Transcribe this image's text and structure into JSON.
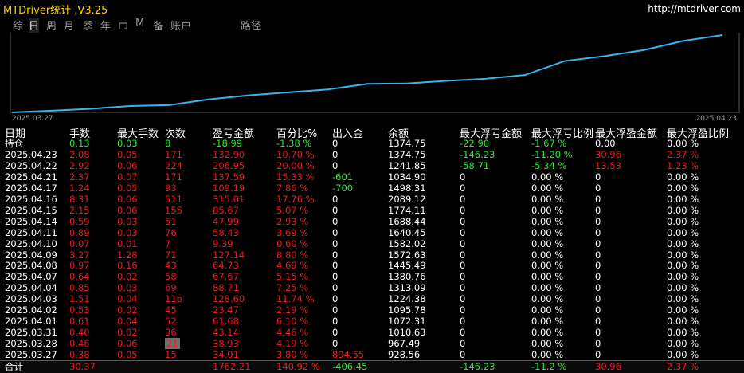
{
  "window": {
    "title": "MTDriver统计 ,V3.25",
    "url": "http://mtdriver.com"
  },
  "colors": {
    "profit": "#e81d1d",
    "loss": "#2ee62e",
    "curve": "#3ab4f0",
    "bg": "#000000"
  },
  "tabs": [
    {
      "label": "综",
      "active": false
    },
    {
      "label": "日",
      "active": true
    },
    {
      "label": "周",
      "active": false
    },
    {
      "label": "月",
      "active": false
    },
    {
      "label": "季",
      "active": false
    },
    {
      "label": "年",
      "active": false
    },
    {
      "label": "巾",
      "active": false
    },
    {
      "label": "M",
      "active": false
    },
    {
      "label": "备",
      "active": false
    },
    {
      "label": "账户",
      "active": false
    },
    {
      "label": "路径",
      "active": false
    }
  ],
  "chart_data": {
    "type": "line",
    "x": [
      "2025.03.27",
      "2025.03.28",
      "2025.03.31",
      "2025.04.01",
      "2025.04.02",
      "2025.04.03",
      "2025.04.04",
      "2025.04.07",
      "2025.04.08",
      "2025.04.09",
      "2025.04.10",
      "2025.04.11",
      "2025.04.14",
      "2025.04.15",
      "2025.04.16",
      "2025.04.17",
      "2025.04.21",
      "2025.04.22",
      "2025.04.23"
    ],
    "series": [
      {
        "values": [
          928.56,
          967.49,
          1010.63,
          1072.31,
          1095.78,
          1224.38,
          1313.09,
          1380.76,
          1445.49,
          1572.63,
          1582.02,
          1640.45,
          1688.44,
          1774.11,
          2089.12,
          2198.31,
          2335.9,
          2542.85,
          2675.75
        ]
      }
    ],
    "x_tick_labels": [
      "2025.03.27",
      "2025.04.23"
    ]
  },
  "headers": {
    "date": "日期",
    "lots": "手数",
    "max_lots": "最大手数",
    "count": "次数",
    "pnl": "盈亏金额",
    "pct": "百分比%",
    "inout": "出入金",
    "balance": "余额",
    "max_float_loss": "最大浮亏金额",
    "max_float_loss_pct": "最大浮亏比例",
    "max_float_profit": "最大浮盈金额",
    "max_float_profit_pct": "最大浮盈比例"
  },
  "rows": [
    {
      "date": "持仓",
      "lots": "0.13",
      "max_lots": "0.03",
      "count": "8",
      "pnl": "-18.99",
      "pct": "-1.38 %",
      "inout": "0",
      "balance": "1374.75",
      "mfl": "-22.90",
      "mflp": "-1.67 %",
      "mfp": "0.00",
      "mfpp": "0.00 %",
      "tone": "green"
    },
    {
      "date": "2025.04.23",
      "lots": "2.08",
      "max_lots": "0.05",
      "count": "171",
      "pnl": "132.90",
      "pct": "10.70 %",
      "inout": "0",
      "balance": "1374.75",
      "mfl": "-146.23",
      "mflp": "-11.20 %",
      "mfp": "30.96",
      "mfpp": "2.37 %",
      "tone": "red"
    },
    {
      "date": "2025.04.22",
      "lots": "2.92",
      "max_lots": "0.06",
      "count": "224",
      "pnl": "206.95",
      "pct": "20.00 %",
      "inout": "0",
      "balance": "1241.85",
      "mfl": "-58.71",
      "mflp": "-5.34 %",
      "mfp": "13.53",
      "mfpp": "1.23 %",
      "tone": "red"
    },
    {
      "date": "2025.04.21",
      "lots": "2.37",
      "max_lots": "0.07",
      "count": "171",
      "pnl": "137.59",
      "pct": "15.33 %",
      "inout": "-601",
      "balance": "1034.90",
      "mfl": "0",
      "mflp": "0.00 %",
      "mfp": "0",
      "mfpp": "0.00 %",
      "tone": "red"
    },
    {
      "date": "2025.04.17",
      "lots": "1.24",
      "max_lots": "0.05",
      "count": "93",
      "pnl": "109.19",
      "pct": "7.86 %",
      "inout": "-700",
      "balance": "1498.31",
      "mfl": "0",
      "mflp": "0.00 %",
      "mfp": "0",
      "mfpp": "0.00 %",
      "tone": "red"
    },
    {
      "date": "2025.04.16",
      "lots": "8.31",
      "max_lots": "0.06",
      "count": "511",
      "pnl": "315.01",
      "pct": "17.76 %",
      "inout": "0",
      "balance": "2089.12",
      "mfl": "0",
      "mflp": "0.00 %",
      "mfp": "0",
      "mfpp": "0.00 %",
      "tone": "red"
    },
    {
      "date": "2025.04.15",
      "lots": "2.15",
      "max_lots": "0.06",
      "count": "155",
      "pnl": "85.67",
      "pct": "5.07 %",
      "inout": "0",
      "balance": "1774.11",
      "mfl": "0",
      "mflp": "0.00 %",
      "mfp": "0",
      "mfpp": "0.00 %",
      "tone": "red"
    },
    {
      "date": "2025.04.14",
      "lots": "0.59",
      "max_lots": "0.03",
      "count": "51",
      "pnl": "47.99",
      "pct": "2.93 %",
      "inout": "0",
      "balance": "1688.44",
      "mfl": "0",
      "mflp": "0.00 %",
      "mfp": "0",
      "mfpp": "0.00 %",
      "tone": "red"
    },
    {
      "date": "2025.04.11",
      "lots": "0.89",
      "max_lots": "0.03",
      "count": "76",
      "pnl": "58.43",
      "pct": "3.69 %",
      "inout": "0",
      "balance": "1640.45",
      "mfl": "0",
      "mflp": "0.00 %",
      "mfp": "0",
      "mfpp": "0.00 %",
      "tone": "red"
    },
    {
      "date": "2025.04.10",
      "lots": "0.07",
      "max_lots": "0.01",
      "count": "7",
      "pnl": "9.39",
      "pct": "0.60 %",
      "inout": "0",
      "balance": "1582.02",
      "mfl": "0",
      "mflp": "0.00 %",
      "mfp": "0",
      "mfpp": "0.00 %",
      "tone": "red"
    },
    {
      "date": "2025.04.09",
      "lots": "3.27",
      "max_lots": "1.28",
      "count": "71",
      "pnl": "127.14",
      "pct": "8.80 %",
      "inout": "0",
      "balance": "1572.63",
      "mfl": "0",
      "mflp": "0.00 %",
      "mfp": "0",
      "mfpp": "0.00 %",
      "tone": "red"
    },
    {
      "date": "2025.04.08",
      "lots": "0.97",
      "max_lots": "0.16",
      "count": "43",
      "pnl": "64.73",
      "pct": "4.69 %",
      "inout": "0",
      "balance": "1445.49",
      "mfl": "0",
      "mflp": "0.00 %",
      "mfp": "0",
      "mfpp": "0.00 %",
      "tone": "red"
    },
    {
      "date": "2025.04.07",
      "lots": "0.64",
      "max_lots": "0.02",
      "count": "58",
      "pnl": "67.67",
      "pct": "5.15 %",
      "inout": "0",
      "balance": "1380.76",
      "mfl": "0",
      "mflp": "0.00 %",
      "mfp": "0",
      "mfpp": "0.00 %",
      "tone": "red"
    },
    {
      "date": "2025.04.04",
      "lots": "0.85",
      "max_lots": "0.03",
      "count": "69",
      "pnl": "88.71",
      "pct": "7.25 %",
      "inout": "0",
      "balance": "1313.09",
      "mfl": "0",
      "mflp": "0.00 %",
      "mfp": "0",
      "mfpp": "0.00 %",
      "tone": "red"
    },
    {
      "date": "2025.04.03",
      "lots": "1.51",
      "max_lots": "0.04",
      "count": "116",
      "pnl": "128.60",
      "pct": "11.74 %",
      "inout": "0",
      "balance": "1224.38",
      "mfl": "0",
      "mflp": "0.00 %",
      "mfp": "0",
      "mfpp": "0.00 %",
      "tone": "red"
    },
    {
      "date": "2025.04.02",
      "lots": "0.53",
      "max_lots": "0.02",
      "count": "45",
      "pnl": "23.47",
      "pct": "2.19 %",
      "inout": "0",
      "balance": "1095.78",
      "mfl": "0",
      "mflp": "0.00 %",
      "mfp": "0",
      "mfpp": "0.00 %",
      "tone": "red"
    },
    {
      "date": "2025.04.01",
      "lots": "0.61",
      "max_lots": "0.04",
      "count": "52",
      "pnl": "61.68",
      "pct": "6.10 %",
      "inout": "0",
      "balance": "1072.31",
      "mfl": "0",
      "mflp": "0.00 %",
      "mfp": "0",
      "mfpp": "0.00 %",
      "tone": "red"
    },
    {
      "date": "2025.03.31",
      "lots": "0.40",
      "max_lots": "0.02",
      "count": "36",
      "pnl": "43.14",
      "pct": "4.46 %",
      "inout": "0",
      "balance": "1010.63",
      "mfl": "0",
      "mflp": "0.00 %",
      "mfp": "0",
      "mfpp": "0.00 %",
      "tone": "red"
    },
    {
      "date": "2025.03.28",
      "lots": "0.46",
      "max_lots": "0.06",
      "count": "21",
      "pnl": "38.93",
      "pct": "4.19 %",
      "inout": "0",
      "balance": "967.49",
      "mfl": "0",
      "mflp": "0.00 %",
      "mfp": "0",
      "mfpp": "0.00 %",
      "tone": "red",
      "count_highlight": true
    },
    {
      "date": "2025.03.27",
      "lots": "0.38",
      "max_lots": "0.05",
      "count": "15",
      "pnl": "34.01",
      "pct": "3.80 %",
      "inout": "894.55",
      "balance": "928.56",
      "mfl": "0",
      "mflp": "0.00 %",
      "mfp": "0",
      "mfpp": "0.00 %",
      "tone": "red"
    }
  ],
  "summary": {
    "date": "合计",
    "lots": "30.37",
    "max_lots": "",
    "count": "",
    "pnl": "1762.21",
    "pct": "140.92 %",
    "inout": "-406.45",
    "balance": "",
    "mfl": "-146.23",
    "mflp": "-11.2 %",
    "mfp": "30.96",
    "mfpp": "2.37 %"
  }
}
